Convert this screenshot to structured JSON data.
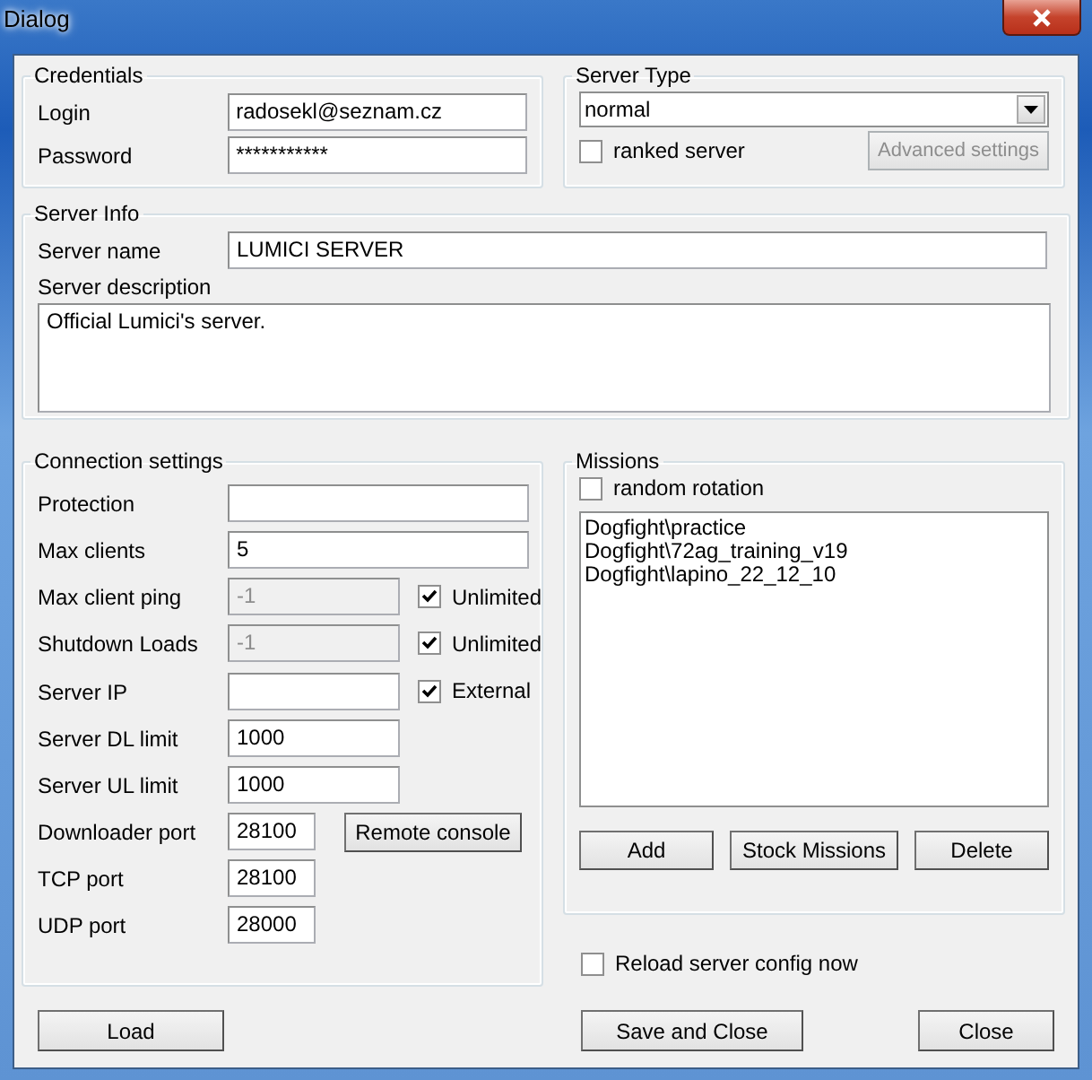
{
  "window": {
    "title": "Dialog"
  },
  "credentials": {
    "title": "Credentials",
    "fields": [
      {
        "label": "Login",
        "value": "radosekl@seznam.cz"
      },
      {
        "label": "Password",
        "value": "***********"
      }
    ]
  },
  "server_type": {
    "title": "Server Type",
    "dropdown": {
      "value": "normal"
    },
    "ranked": {
      "label": "ranked server",
      "checked": false
    },
    "advanced": {
      "label": "Advanced settings",
      "disabled": true
    }
  },
  "server_info": {
    "title": "Server Info",
    "name_label": "Server name",
    "name_value": "LUMICI SERVER",
    "description_label": "Server description",
    "description_value": "Official Lumici's server."
  },
  "connection": {
    "title": "Connection settings",
    "rows": [
      {
        "label": "Protection",
        "value": "",
        "disabled": false
      },
      {
        "label": "Max clients",
        "value": "5",
        "disabled": false
      },
      {
        "label": "Max client ping",
        "value": "-1",
        "disabled": true,
        "side": {
          "kind": "checkbox",
          "label": "Unlimited",
          "checked": true
        }
      },
      {
        "label": "Shutdown Loads",
        "value": "-1",
        "disabled": true,
        "side": {
          "kind": "checkbox",
          "label": "Unlimited",
          "checked": true
        }
      },
      {
        "label": "Server IP",
        "value": "",
        "disabled": false,
        "side": {
          "kind": "checkbox",
          "label": "External",
          "checked": true
        }
      },
      {
        "label": "Server DL limit",
        "value": "1000",
        "disabled": false
      },
      {
        "label": "Server UL limit",
        "value": "1000",
        "disabled": false
      },
      {
        "label": "Downloader port",
        "value": "28100",
        "disabled": false,
        "side": {
          "kind": "button",
          "label": "Remote console"
        }
      },
      {
        "label": "TCP port",
        "value": "28100",
        "disabled": false
      },
      {
        "label": "UDP port",
        "value": "28000",
        "disabled": false
      }
    ]
  },
  "missions": {
    "title": "Missions",
    "random_rotation": {
      "label": "random rotation",
      "checked": false
    },
    "items": [
      "Dogfight\\practice",
      "Dogfight\\72ag_training_v19",
      "Dogfight\\lapino_22_12_10"
    ],
    "buttons": [
      "Add",
      "Stock Missions",
      "Delete"
    ]
  },
  "reload": {
    "label": "Reload server config now",
    "checked": false
  },
  "buttons": [
    "Load",
    "Save and Close",
    "Close"
  ]
}
